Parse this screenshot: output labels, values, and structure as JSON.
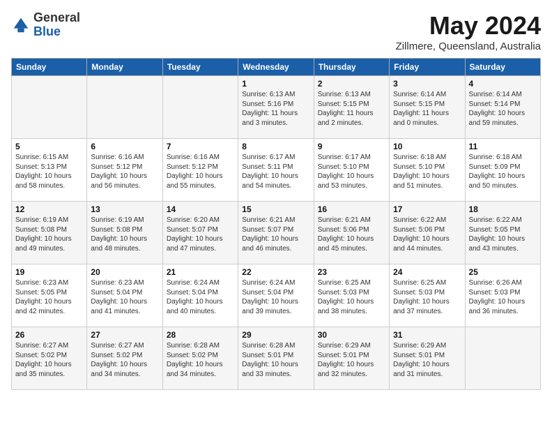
{
  "header": {
    "logo_general": "General",
    "logo_blue": "Blue",
    "month_title": "May 2024",
    "location": "Zillmere, Queensland, Australia"
  },
  "weekdays": [
    "Sunday",
    "Monday",
    "Tuesday",
    "Wednesday",
    "Thursday",
    "Friday",
    "Saturday"
  ],
  "weeks": [
    [
      {
        "day": "",
        "info": ""
      },
      {
        "day": "",
        "info": ""
      },
      {
        "day": "",
        "info": ""
      },
      {
        "day": "1",
        "info": "Sunrise: 6:13 AM\nSunset: 5:16 PM\nDaylight: 11 hours\nand 3 minutes."
      },
      {
        "day": "2",
        "info": "Sunrise: 6:13 AM\nSunset: 5:15 PM\nDaylight: 11 hours\nand 2 minutes."
      },
      {
        "day": "3",
        "info": "Sunrise: 6:14 AM\nSunset: 5:15 PM\nDaylight: 11 hours\nand 0 minutes."
      },
      {
        "day": "4",
        "info": "Sunrise: 6:14 AM\nSunset: 5:14 PM\nDaylight: 10 hours\nand 59 minutes."
      }
    ],
    [
      {
        "day": "5",
        "info": "Sunrise: 6:15 AM\nSunset: 5:13 PM\nDaylight: 10 hours\nand 58 minutes."
      },
      {
        "day": "6",
        "info": "Sunrise: 6:16 AM\nSunset: 5:12 PM\nDaylight: 10 hours\nand 56 minutes."
      },
      {
        "day": "7",
        "info": "Sunrise: 6:16 AM\nSunset: 5:12 PM\nDaylight: 10 hours\nand 55 minutes."
      },
      {
        "day": "8",
        "info": "Sunrise: 6:17 AM\nSunset: 5:11 PM\nDaylight: 10 hours\nand 54 minutes."
      },
      {
        "day": "9",
        "info": "Sunrise: 6:17 AM\nSunset: 5:10 PM\nDaylight: 10 hours\nand 53 minutes."
      },
      {
        "day": "10",
        "info": "Sunrise: 6:18 AM\nSunset: 5:10 PM\nDaylight: 10 hours\nand 51 minutes."
      },
      {
        "day": "11",
        "info": "Sunrise: 6:18 AM\nSunset: 5:09 PM\nDaylight: 10 hours\nand 50 minutes."
      }
    ],
    [
      {
        "day": "12",
        "info": "Sunrise: 6:19 AM\nSunset: 5:08 PM\nDaylight: 10 hours\nand 49 minutes."
      },
      {
        "day": "13",
        "info": "Sunrise: 6:19 AM\nSunset: 5:08 PM\nDaylight: 10 hours\nand 48 minutes."
      },
      {
        "day": "14",
        "info": "Sunrise: 6:20 AM\nSunset: 5:07 PM\nDaylight: 10 hours\nand 47 minutes."
      },
      {
        "day": "15",
        "info": "Sunrise: 6:21 AM\nSunset: 5:07 PM\nDaylight: 10 hours\nand 46 minutes."
      },
      {
        "day": "16",
        "info": "Sunrise: 6:21 AM\nSunset: 5:06 PM\nDaylight: 10 hours\nand 45 minutes."
      },
      {
        "day": "17",
        "info": "Sunrise: 6:22 AM\nSunset: 5:06 PM\nDaylight: 10 hours\nand 44 minutes."
      },
      {
        "day": "18",
        "info": "Sunrise: 6:22 AM\nSunset: 5:05 PM\nDaylight: 10 hours\nand 43 minutes."
      }
    ],
    [
      {
        "day": "19",
        "info": "Sunrise: 6:23 AM\nSunset: 5:05 PM\nDaylight: 10 hours\nand 42 minutes."
      },
      {
        "day": "20",
        "info": "Sunrise: 6:23 AM\nSunset: 5:04 PM\nDaylight: 10 hours\nand 41 minutes."
      },
      {
        "day": "21",
        "info": "Sunrise: 6:24 AM\nSunset: 5:04 PM\nDaylight: 10 hours\nand 40 minutes."
      },
      {
        "day": "22",
        "info": "Sunrise: 6:24 AM\nSunset: 5:04 PM\nDaylight: 10 hours\nand 39 minutes."
      },
      {
        "day": "23",
        "info": "Sunrise: 6:25 AM\nSunset: 5:03 PM\nDaylight: 10 hours\nand 38 minutes."
      },
      {
        "day": "24",
        "info": "Sunrise: 6:25 AM\nSunset: 5:03 PM\nDaylight: 10 hours\nand 37 minutes."
      },
      {
        "day": "25",
        "info": "Sunrise: 6:26 AM\nSunset: 5:03 PM\nDaylight: 10 hours\nand 36 minutes."
      }
    ],
    [
      {
        "day": "26",
        "info": "Sunrise: 6:27 AM\nSunset: 5:02 PM\nDaylight: 10 hours\nand 35 minutes."
      },
      {
        "day": "27",
        "info": "Sunrise: 6:27 AM\nSunset: 5:02 PM\nDaylight: 10 hours\nand 34 minutes."
      },
      {
        "day": "28",
        "info": "Sunrise: 6:28 AM\nSunset: 5:02 PM\nDaylight: 10 hours\nand 34 minutes."
      },
      {
        "day": "29",
        "info": "Sunrise: 6:28 AM\nSunset: 5:01 PM\nDaylight: 10 hours\nand 33 minutes."
      },
      {
        "day": "30",
        "info": "Sunrise: 6:29 AM\nSunset: 5:01 PM\nDaylight: 10 hours\nand 32 minutes."
      },
      {
        "day": "31",
        "info": "Sunrise: 6:29 AM\nSunset: 5:01 PM\nDaylight: 10 hours\nand 31 minutes."
      },
      {
        "day": "",
        "info": ""
      }
    ]
  ]
}
